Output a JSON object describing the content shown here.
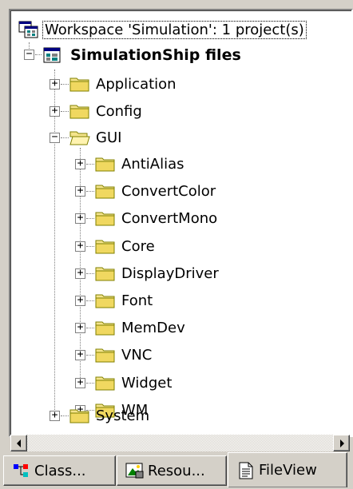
{
  "tree": {
    "workspace": {
      "label": "Workspace 'Simulation': 1 project(s)",
      "icon": "workspace-icon"
    },
    "project": {
      "label": "SimulationShip files",
      "icon": "project-icon",
      "expanded": true
    },
    "folders": [
      {
        "label": "Application",
        "expanded": false
      },
      {
        "label": "Config",
        "expanded": false
      },
      {
        "label": "GUI",
        "expanded": true,
        "children": [
          {
            "label": "AntiAlias"
          },
          {
            "label": "ConvertColor"
          },
          {
            "label": "ConvertMono"
          },
          {
            "label": "Core"
          },
          {
            "label": "DisplayDriver"
          },
          {
            "label": "Font"
          },
          {
            "label": "MemDev"
          },
          {
            "label": "VNC"
          },
          {
            "label": "Widget"
          },
          {
            "label": "WM"
          }
        ]
      },
      {
        "label": "System",
        "expanded": false
      }
    ],
    "expander_collapsed": "+",
    "expander_expanded": "−"
  },
  "scrollbar": {
    "left_arrow": "left-arrow-icon",
    "right_arrow": "right-arrow-icon"
  },
  "tabs": [
    {
      "label": "Class...",
      "icon": "class-view-icon",
      "active": false
    },
    {
      "label": "Resou...",
      "icon": "resource-view-icon",
      "active": false
    },
    {
      "label": "FileView",
      "icon": "file-view-icon",
      "active": true
    }
  ],
  "colors": {
    "folder_fill": "#f5e48c",
    "folder_outline": "#808000",
    "panel_bg": "#d4d0c8"
  }
}
